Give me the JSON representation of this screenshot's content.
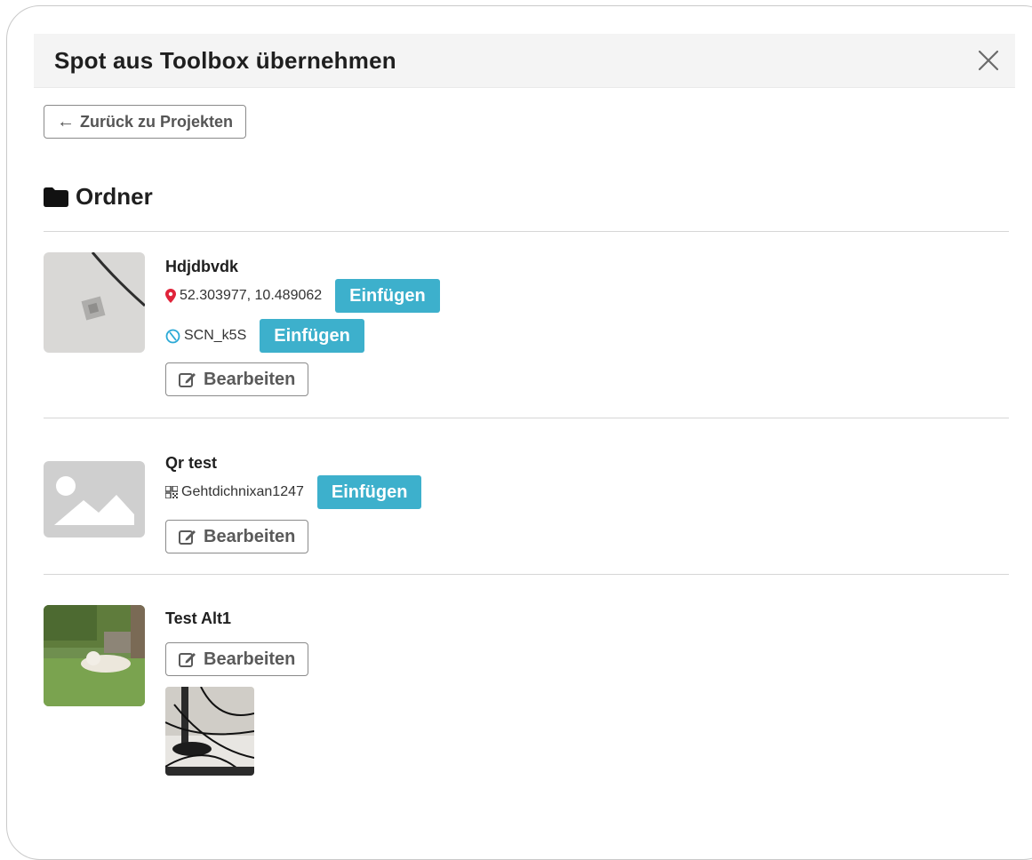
{
  "modal": {
    "title": "Spot aus Toolbox übernehmen",
    "back_label": "Zurück zu Projekten",
    "section_title": "Ordner"
  },
  "spots": [
    {
      "name": "Hdjdbvdk",
      "location": "52.303977, 10.489062",
      "location_insert": "Einfügen",
      "nfc": "SCN_k5S",
      "nfc_insert": "Einfügen",
      "edit": "Bearbeiten"
    },
    {
      "name": "Qr test",
      "qr": "Gehtdichnixan1247",
      "qr_insert": "Einfügen",
      "edit": "Bearbeiten"
    },
    {
      "name": "Test Alt1",
      "edit": "Bearbeiten"
    }
  ],
  "colors": {
    "accent": "#3db0cc",
    "location_pin": "#e0243a",
    "nfc_icon": "#2ba9d6"
  },
  "icons": [
    "close-icon",
    "arrow-left-icon",
    "folder-icon",
    "map-marker-icon",
    "nfc-icon",
    "qr-code-icon",
    "edit-icon",
    "image-placeholder-icon"
  ]
}
